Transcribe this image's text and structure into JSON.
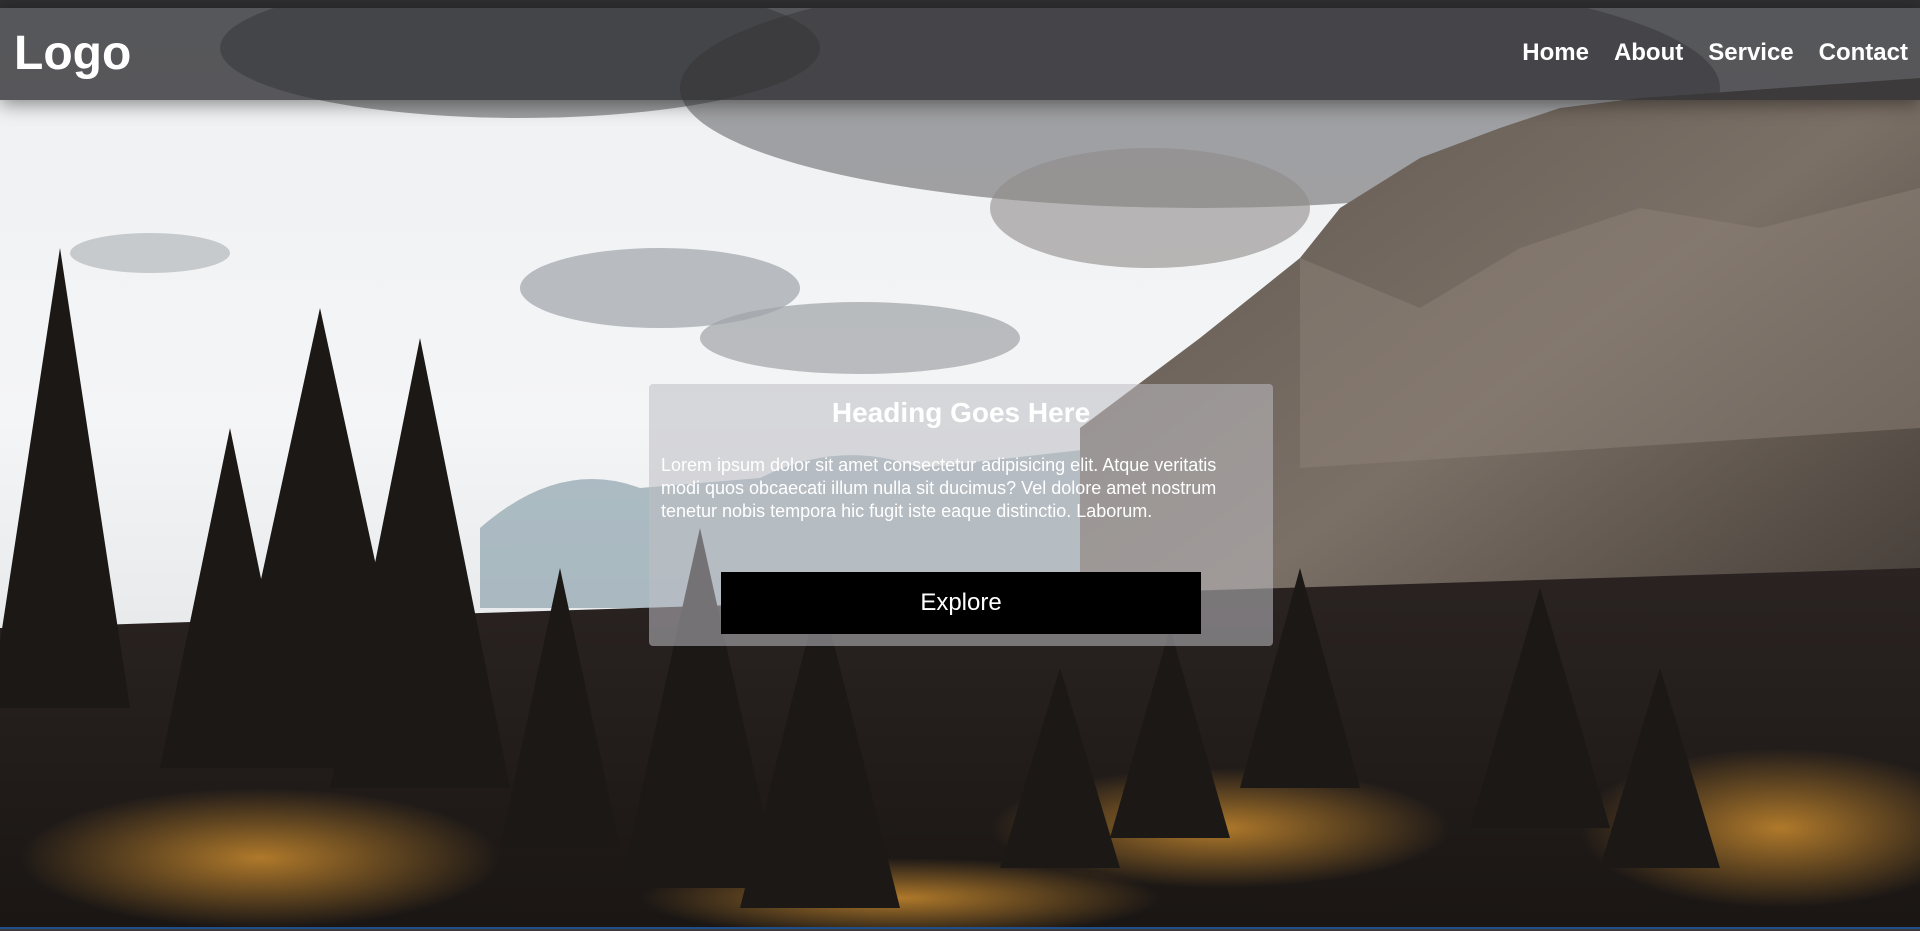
{
  "header": {
    "logo": "Logo",
    "nav": [
      {
        "label": "Home"
      },
      {
        "label": "About"
      },
      {
        "label": "Service"
      },
      {
        "label": "Contact"
      }
    ]
  },
  "hero": {
    "heading": "Heading Goes Here",
    "body": "Lorem ipsum dolor sit amet consectetur adipisicing elit. Atque veritatis modi quos obcaecati illum nulla sit ducimus? Vel dolore amet nostrum tenetur nobis tempora hic fugit iste eaque distinctio. Laborum.",
    "button_label": "Explore"
  },
  "colors": {
    "navbar_bg": "#2c2c30",
    "button_bg": "#000000",
    "text": "#ffffff"
  }
}
